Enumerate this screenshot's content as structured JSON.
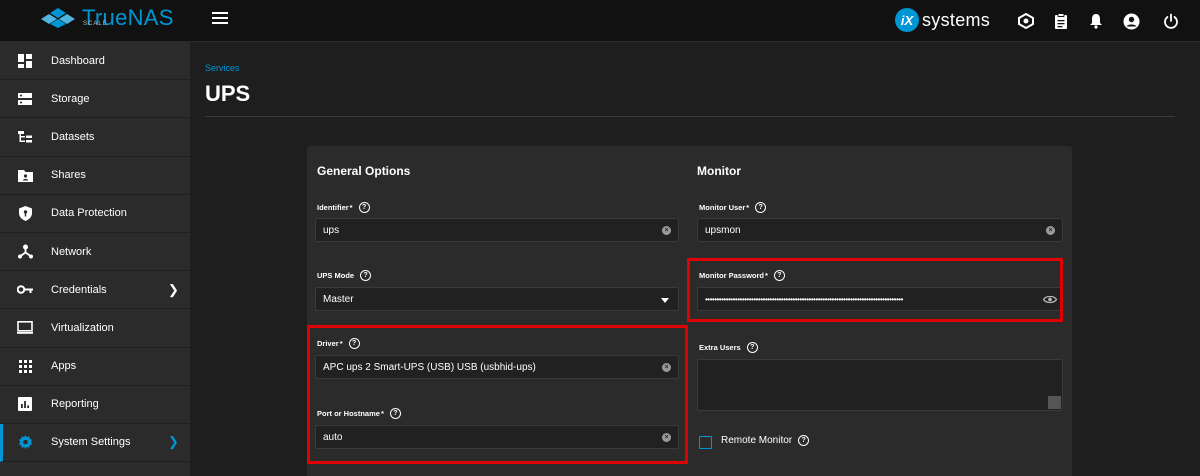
{
  "topbar": {
    "brand": "TrueNAS",
    "brand_sub": "SCALE",
    "vendor_mark": "iX",
    "vendor_text": "systems"
  },
  "sidebar": {
    "items": [
      {
        "label": "Dashboard",
        "icon": "dashboard-icon"
      },
      {
        "label": "Storage",
        "icon": "storage-icon"
      },
      {
        "label": "Datasets",
        "icon": "datasets-icon"
      },
      {
        "label": "Shares",
        "icon": "shares-icon"
      },
      {
        "label": "Data Protection",
        "icon": "shield-icon"
      },
      {
        "label": "Network",
        "icon": "network-icon"
      },
      {
        "label": "Credentials",
        "icon": "key-icon"
      },
      {
        "label": "Virtualization",
        "icon": "monitor-icon"
      },
      {
        "label": "Apps",
        "icon": "apps-grid-icon"
      },
      {
        "label": "Reporting",
        "icon": "reporting-icon"
      },
      {
        "label": "System Settings",
        "icon": "gear-icon"
      }
    ],
    "chevron": "❯"
  },
  "page": {
    "breadcrumb": "Services",
    "title": "UPS"
  },
  "general": {
    "title": "General Options",
    "identifier_label": "Identifier",
    "identifier_value": "ups",
    "mode_label": "UPS Mode",
    "mode_value": "Master",
    "driver_label": "Driver",
    "driver_value": "APC ups 2 Smart-UPS (USB) USB (usbhid-ups)",
    "port_label": "Port or Hostname",
    "port_value": "auto"
  },
  "monitor": {
    "title": "Monitor",
    "user_label": "Monitor User",
    "user_value": "upsmon",
    "password_label": "Monitor Password",
    "password_value": "••••••••••••••••••••••••••••••••••••••••••••••••••••••••••••••••••••••••••••••••••••••",
    "extra_users_label": "Extra Users",
    "remote_monitor_label": "Remote Monitor"
  },
  "common": {
    "required": "*",
    "help": "?",
    "clear": "×"
  },
  "colors": {
    "accent": "#0095d5",
    "highlight": "#e00000",
    "sidebar_bg": "#2b2b2b",
    "topbar_bg": "#111111"
  }
}
